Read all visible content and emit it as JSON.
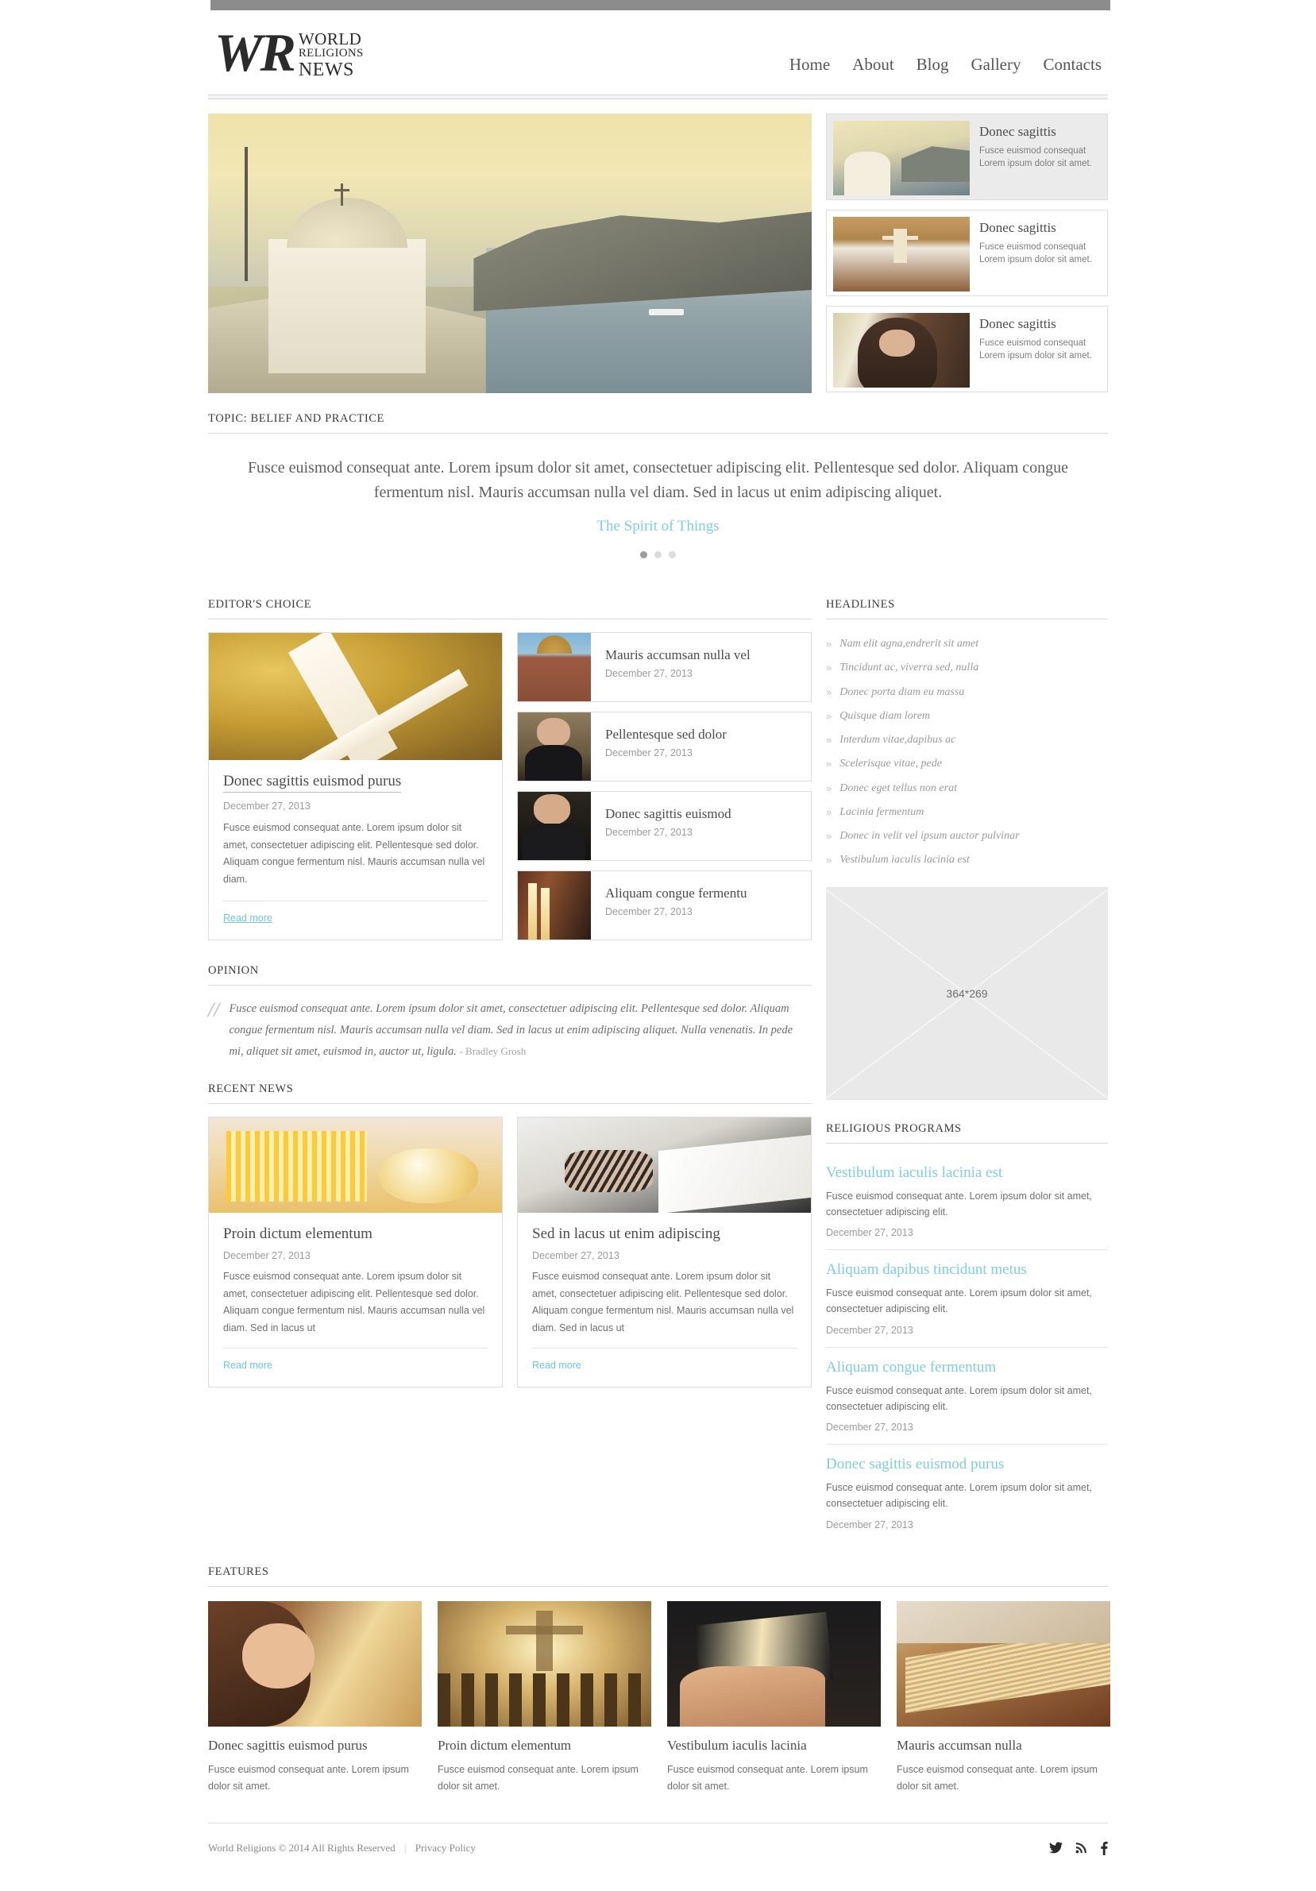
{
  "brand": {
    "mark": "WR",
    "line1": "WORLD",
    "line2": "RELIGIONS",
    "line3": "NEWS"
  },
  "nav": [
    {
      "label": "Home"
    },
    {
      "label": "About"
    },
    {
      "label": "Blog"
    },
    {
      "label": "Gallery"
    },
    {
      "label": "Contacts"
    }
  ],
  "hero": {
    "cards": [
      {
        "title": "Donec sagittis",
        "line1": "Fusce euismod consequat",
        "line2": "Lorem ipsum dolor sit amet."
      },
      {
        "title": "Donec sagittis",
        "line1": "Fusce euismod consequat",
        "line2": "Lorem ipsum dolor sit amet."
      },
      {
        "title": "Donec sagittis",
        "line1": "Fusce euismod consequat",
        "line2": "Lorem ipsum dolor sit amet."
      }
    ]
  },
  "topic": {
    "heading": "TOPIC: BELIEF AND PRACTICE",
    "paragraph": "Fusce euismod consequat ante. Lorem ipsum dolor sit amet, consectetuer adipiscing elit. Pellentesque sed dolor. Aliquam congue fermentum nisl. Mauris accumsan nulla vel diam. Sed in lacus ut enim adipiscing aliquet.",
    "link": "The Spirit of Things"
  },
  "editors_choice": {
    "heading": "EDITOR'S CHOICE",
    "feature": {
      "title": "Donec sagittis euismod purus",
      "date": "December 27, 2013",
      "excerpt": "Fusce euismod consequat ante. Lorem ipsum dolor sit amet, consectetuer adipiscing elit. Pellentesque sed dolor. Aliquam congue fermentum nisl. Mauris accumsan nulla vel diam.",
      "read_more": "Read more"
    },
    "items": [
      {
        "title": "Mauris accumsan nulla vel",
        "date": "December 27, 2013"
      },
      {
        "title": "Pellentesque sed dolor",
        "date": "December 27, 2013"
      },
      {
        "title": "Donec sagittis euismod",
        "date": "December 27, 2013"
      },
      {
        "title": "Aliquam congue fermentu",
        "date": "December 27, 2013"
      }
    ]
  },
  "headlines": {
    "heading": "HEADLINES",
    "bullet": "»",
    "items": [
      {
        "text": "Nam elit agna,endrerit sit amet"
      },
      {
        "text": "Tincidunt ac, viverra sed, nulla"
      },
      {
        "text": "Donec porta diam eu massa"
      },
      {
        "text": "Quisque diam lorem"
      },
      {
        "text": "Interdum vitae,dapibus ac"
      },
      {
        "text": "Scelerisque vitae, pede"
      },
      {
        "text": "Donec eget tellus non erat"
      },
      {
        "text": "Lacinia fermentum"
      },
      {
        "text": "Donec in velit vel ipsum auctor pulvinar"
      },
      {
        "text": "Vestibulum iaculis lacinia est"
      }
    ]
  },
  "placeholder": {
    "label": "364*269"
  },
  "opinion": {
    "heading": "OPINION",
    "quote": "Fusce euismod consequat ante. Lorem ipsum dolor sit amet, consectetuer adipiscing elit. Pellentesque sed dolor. Aliquam congue fermentum nisl. Mauris accumsan nulla vel diam. Sed in lacus ut enim adipiscing aliquet. Nulla venenatis. In pede mi, aliquet sit amet, euismod in, auctor ut, ligula.",
    "author": "- Bradley Grosh"
  },
  "recent_news": {
    "heading": "RECENT NEWS",
    "items": [
      {
        "title": "Proin dictum elementum",
        "date": "December 27, 2013",
        "excerpt": "Fusce euismod consequat ante. Lorem ipsum dolor sit amet, consectetuer adipiscing elit. Pellentesque sed dolor. Aliquam congue fermentum nisl. Mauris accumsan nulla vel diam. Sed in lacus ut",
        "read_more": "Read more"
      },
      {
        "title": "Sed in lacus ut enim adipiscing",
        "date": "December 27, 2013",
        "excerpt": "Fusce euismod consequat ante. Lorem ipsum dolor sit amet, consectetuer adipiscing elit. Pellentesque sed dolor. Aliquam congue fermentum nisl. Mauris accumsan nulla vel diam. Sed in lacus ut",
        "read_more": "Read more"
      }
    ]
  },
  "religious_programs": {
    "heading": "RELIGIOUS PROGRAMS",
    "items": [
      {
        "title": "Vestibulum iaculis lacinia est",
        "text": "Fusce euismod consequat ante. Lorem ipsum dolor sit amet, consectetuer adipiscing elit.",
        "date": "December 27, 2013"
      },
      {
        "title": "Aliquam dapibus tincidunt metus",
        "text": "Fusce euismod consequat ante. Lorem ipsum dolor sit amet, consectetuer adipiscing elit.",
        "date": "December 27, 2013"
      },
      {
        "title": "Aliquam congue fermentum",
        "text": "Fusce euismod consequat ante. Lorem ipsum dolor sit amet, consectetuer adipiscing elit.",
        "date": "December 27, 2013"
      },
      {
        "title": "Donec sagittis euismod purus",
        "text": "Fusce euismod consequat ante. Lorem ipsum dolor sit amet, consectetuer adipiscing elit.",
        "date": "December 27, 2013"
      }
    ]
  },
  "features": {
    "heading": "FEATURES",
    "items": [
      {
        "title": "Donec sagittis euismod purus",
        "text": "Fusce euismod consequat ante. Lorem ipsum dolor sit amet."
      },
      {
        "title": "Proin dictum elementum",
        "text": "Fusce euismod consequat ante. Lorem ipsum dolor sit amet."
      },
      {
        "title": "Vestibulum iaculis lacinia",
        "text": "Fusce euismod consequat ante. Lorem ipsum dolor sit amet."
      },
      {
        "title": "Mauris accumsan nulla",
        "text": "Fusce euismod consequat ante. Lorem ipsum dolor sit amet."
      }
    ]
  },
  "footer": {
    "copyright": "World Religions © 2014 All Rights Reserved",
    "separator": "|",
    "privacy": "Privacy Policy",
    "social": [
      {
        "name": "twitter-icon"
      },
      {
        "name": "rss-icon"
      },
      {
        "name": "facebook-icon"
      }
    ]
  },
  "colors": {
    "accent": "#7ecce6",
    "topbar": "#8c8c8c",
    "text": "#4b4b4b",
    "muted": "#9b9b9b"
  }
}
